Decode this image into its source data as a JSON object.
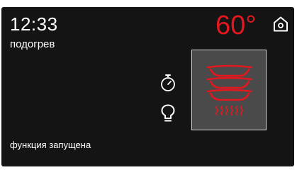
{
  "status_bar": {
    "time": "12:33",
    "mode": "подогрев"
  },
  "temperature": {
    "value": "60°",
    "color": "#e3181f"
  },
  "controls": {
    "home_icon": "home-icon",
    "timer_icon": "stopwatch-icon",
    "light_icon": "lamp-icon"
  },
  "function_panel": {
    "icon": "plates-warming-icon",
    "active_color": "#e3181f"
  },
  "status_message": "функция запущена",
  "colors": {
    "background": "#141414",
    "text": "#ffffff",
    "accent": "#e3181f",
    "panel": "#4a4a4a"
  }
}
